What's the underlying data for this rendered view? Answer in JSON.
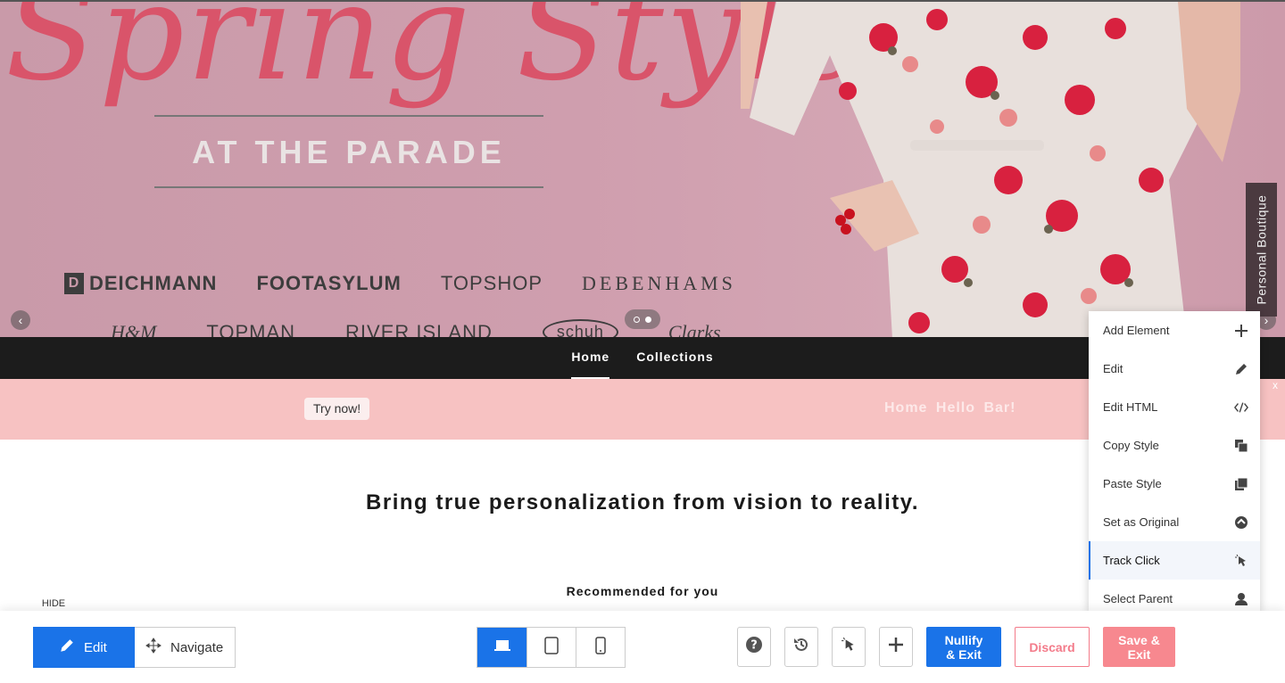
{
  "hero": {
    "script_title": "Spring Style",
    "subtitle": "AT THE PARADE",
    "brands_row1": [
      "DEICHMANN",
      "FOOTASYLUM",
      "TOPSHOP",
      "DEBENHAMS"
    ],
    "brands_row2": [
      "H&M",
      "TOPMAN",
      "RIVER ISLAND",
      "schuh",
      "Clarks"
    ],
    "side_tab": "Personal Boutique",
    "prev_icon": "chevron-left-icon",
    "next_icon": "chevron-right-icon"
  },
  "nav": {
    "items": [
      "Home",
      "Collections"
    ],
    "active": "Home"
  },
  "hellobar": {
    "button": "Try now!",
    "text": "Home Hello Bar!",
    "close": "x"
  },
  "content": {
    "tagline": "Bring true personalization from vision to reality.",
    "recommended": "Recommended for you"
  },
  "context_menu": {
    "items": [
      {
        "label": "Add Element",
        "icon": "plus-icon"
      },
      {
        "label": "Edit",
        "icon": "pencil-icon"
      },
      {
        "label": "Edit HTML",
        "icon": "code-icon"
      },
      {
        "label": "Copy Style",
        "icon": "copy-icon"
      },
      {
        "label": "Paste Style",
        "icon": "paste-icon"
      },
      {
        "label": "Set as Original",
        "icon": "restore-icon"
      },
      {
        "label": "Track Click",
        "icon": "cursor-click-icon"
      },
      {
        "label": "Select Parent",
        "icon": "parent-icon"
      }
    ],
    "active": "Track Click"
  },
  "toolbar": {
    "hide_label": "HIDE",
    "edit_label": "Edit",
    "navigate_label": "Navigate",
    "nullify_label_1": "Nullify",
    "nullify_label_2": "& Exit",
    "discard_label": "Discard",
    "save_label_1": "Save &",
    "save_label_2": "Exit"
  },
  "colors": {
    "primary": "#1a73e8",
    "hellobar": "#f7c2c2",
    "save": "#f7888f",
    "discard": "#f37b8a",
    "nav": "#1c1c1c"
  }
}
